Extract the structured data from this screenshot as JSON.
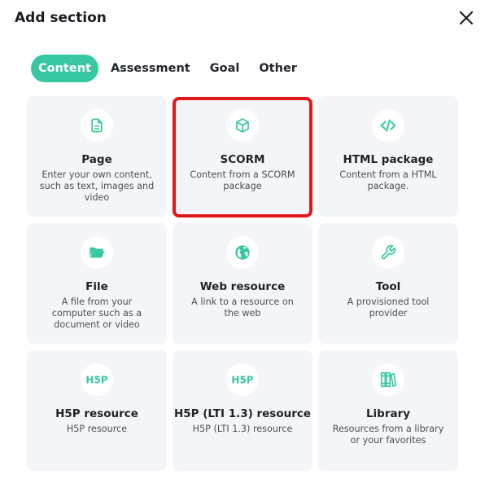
{
  "dialog": {
    "title": "Add section",
    "close_icon": "close-icon"
  },
  "tabs": [
    {
      "label": "Content",
      "active": true
    },
    {
      "label": "Assessment",
      "active": false
    },
    {
      "label": "Goal",
      "active": false
    },
    {
      "label": "Other",
      "active": false
    }
  ],
  "cards": [
    {
      "title": "Page",
      "desc": "Enter your own content, such as text, images and video",
      "icon": "document-icon"
    },
    {
      "title": "SCORM",
      "desc": "Content from a SCORM package",
      "icon": "package-cube-icon"
    },
    {
      "title": "HTML package",
      "desc": "Content from a HTML package.",
      "icon": "code-brackets-icon"
    },
    {
      "title": "File",
      "desc": "A file from your computer such as a document or video",
      "icon": "folder-open-icon"
    },
    {
      "title": "Web resource",
      "desc": "A link to a resource on the web",
      "icon": "globe-icon"
    },
    {
      "title": "Tool",
      "desc": "A provisioned tool provider",
      "icon": "wrench-icon"
    },
    {
      "title": "H5P resource",
      "desc": "H5P resource",
      "icon": "h5p-logo-icon"
    },
    {
      "title": "H5P (LTI 1.3) resource",
      "desc": "H5P (LTI 1.3) resource",
      "icon": "h5p-logo-icon"
    },
    {
      "title": "Library",
      "desc": "Resources from a library or your favorites",
      "icon": "books-icon"
    }
  ],
  "h5p_logo_text": "H5P",
  "colors": {
    "accent": "#37c7a3",
    "card_bg": "#f3f5f8",
    "highlight": "#e11818"
  }
}
